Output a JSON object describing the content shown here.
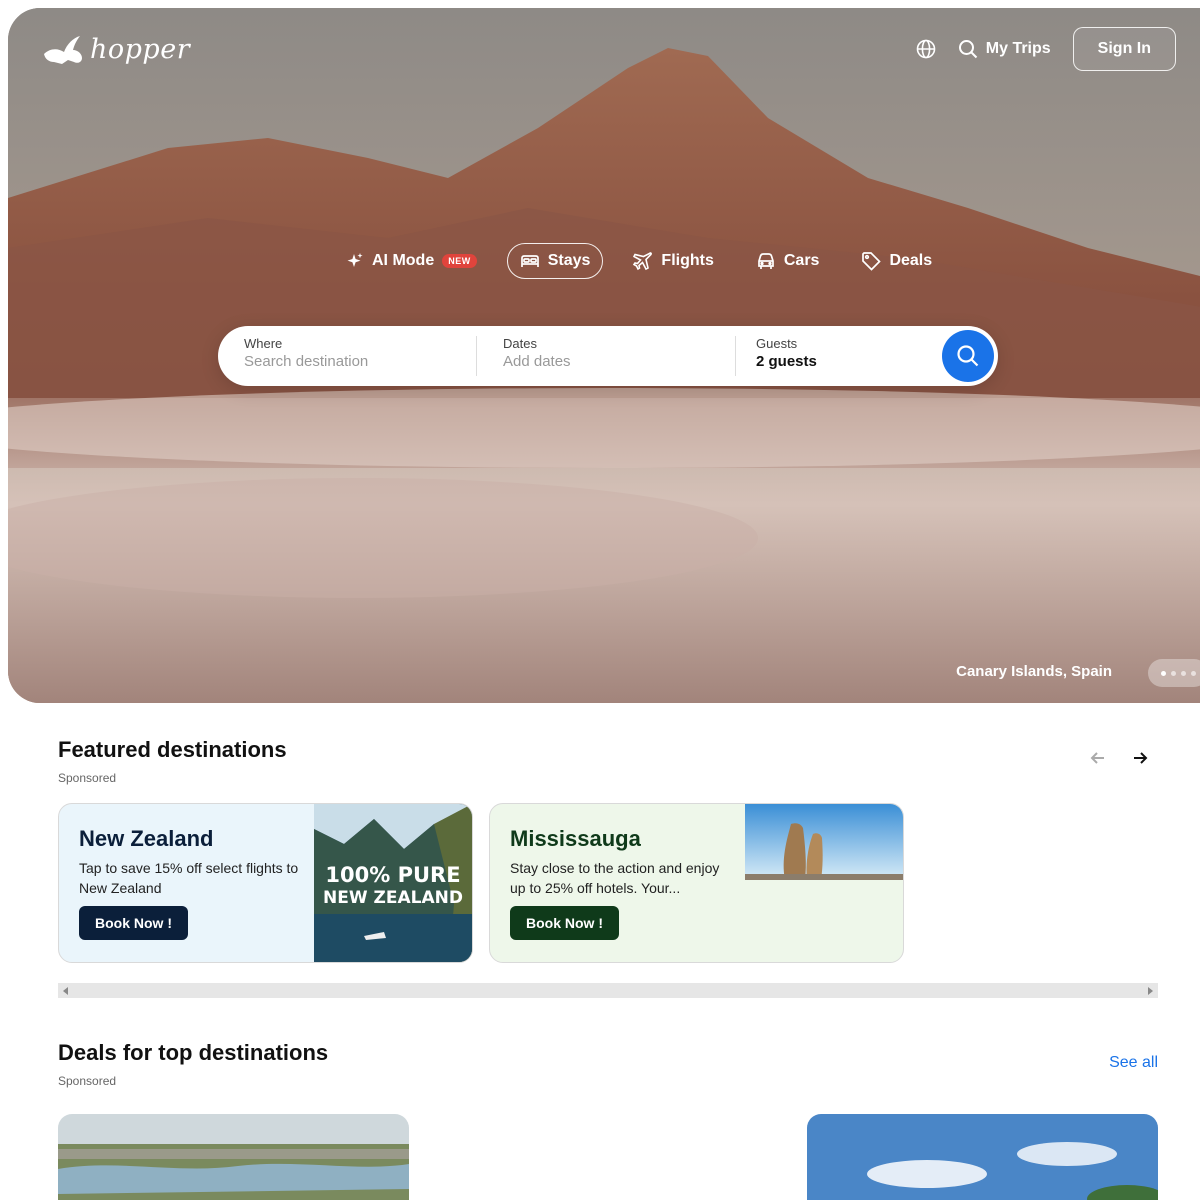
{
  "brand": {
    "name": "hopper"
  },
  "header": {
    "icons": {
      "language": "globe-icon",
      "search": "search-icon"
    },
    "my_trips": "My Trips",
    "sign_in": "Sign In"
  },
  "tabs": [
    {
      "label": "AI Mode",
      "icon": "sparkle-icon",
      "badge": "NEW"
    },
    {
      "label": "Stays",
      "icon": "bed-icon",
      "active": true
    },
    {
      "label": "Flights",
      "icon": "plane-icon"
    },
    {
      "label": "Cars",
      "icon": "car-icon"
    },
    {
      "label": "Deals",
      "icon": "tag-icon"
    }
  ],
  "search": {
    "where_label": "Where",
    "where_placeholder": "Search destination",
    "dates_label": "Dates",
    "dates_placeholder": "Add dates",
    "guests_label": "Guests",
    "guests_value": "2 guests",
    "button_icon": "search-icon"
  },
  "hero": {
    "location": "Canary Islands, Spain",
    "slides": 4,
    "active_slide": 1
  },
  "featured": {
    "title": "Featured destinations",
    "sponsored": "Sponsored",
    "cards": [
      {
        "title": "New Zealand",
        "body": "Tap to save 15% off select flights to New Zealand",
        "cta": "Book Now !",
        "image_text_1": "100% PURE",
        "image_text_2": "NEW ZEALAND",
        "bg": "#eaf5fb",
        "title_color": "#0b1f3a",
        "cta_bg": "#0b1f3a"
      },
      {
        "title": "Mississauga",
        "body": "Stay close to the action and enjoy up to 25% off hotels. Your...",
        "cta": "Book Now !",
        "bg": "#eef7ea",
        "title_color": "#0f3a1a",
        "cta_bg": "#0f3a1a"
      }
    ]
  },
  "deals": {
    "title": "Deals for top destinations",
    "sponsored": "Sponsored",
    "see_all": "See all"
  },
  "colors": {
    "accent": "#1a73e8",
    "badge_red": "#e0443c"
  }
}
